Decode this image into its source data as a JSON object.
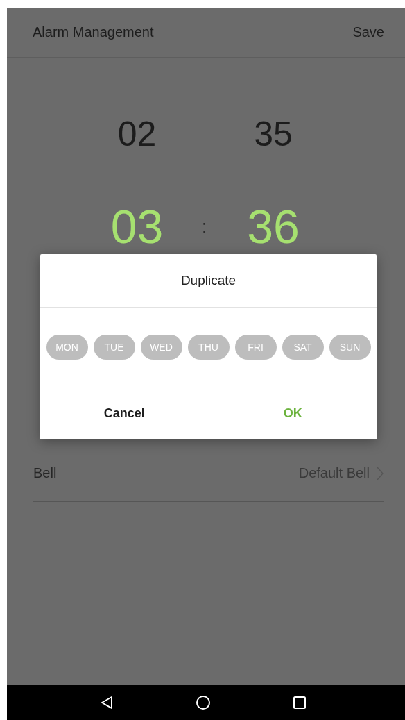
{
  "header": {
    "title": "Alarm Management",
    "action": "Save"
  },
  "time_picker": {
    "previous": {
      "hour": "02",
      "minute": "35"
    },
    "selected": {
      "hour": "03",
      "minute": "36"
    },
    "separator": ":"
  },
  "settings": [
    {
      "label": "Bell",
      "value": "Default Bell"
    }
  ],
  "dialog": {
    "title": "Duplicate",
    "days": [
      {
        "label": "MON",
        "selected": false
      },
      {
        "label": "TUE",
        "selected": false
      },
      {
        "label": "WED",
        "selected": false
      },
      {
        "label": "THU",
        "selected": false
      },
      {
        "label": "FRI",
        "selected": false
      },
      {
        "label": "SAT",
        "selected": false
      },
      {
        "label": "SUN",
        "selected": false
      }
    ],
    "buttons": [
      {
        "label": "Cancel",
        "kind": "cancel"
      },
      {
        "label": "OK",
        "kind": "confirm"
      }
    ]
  }
}
